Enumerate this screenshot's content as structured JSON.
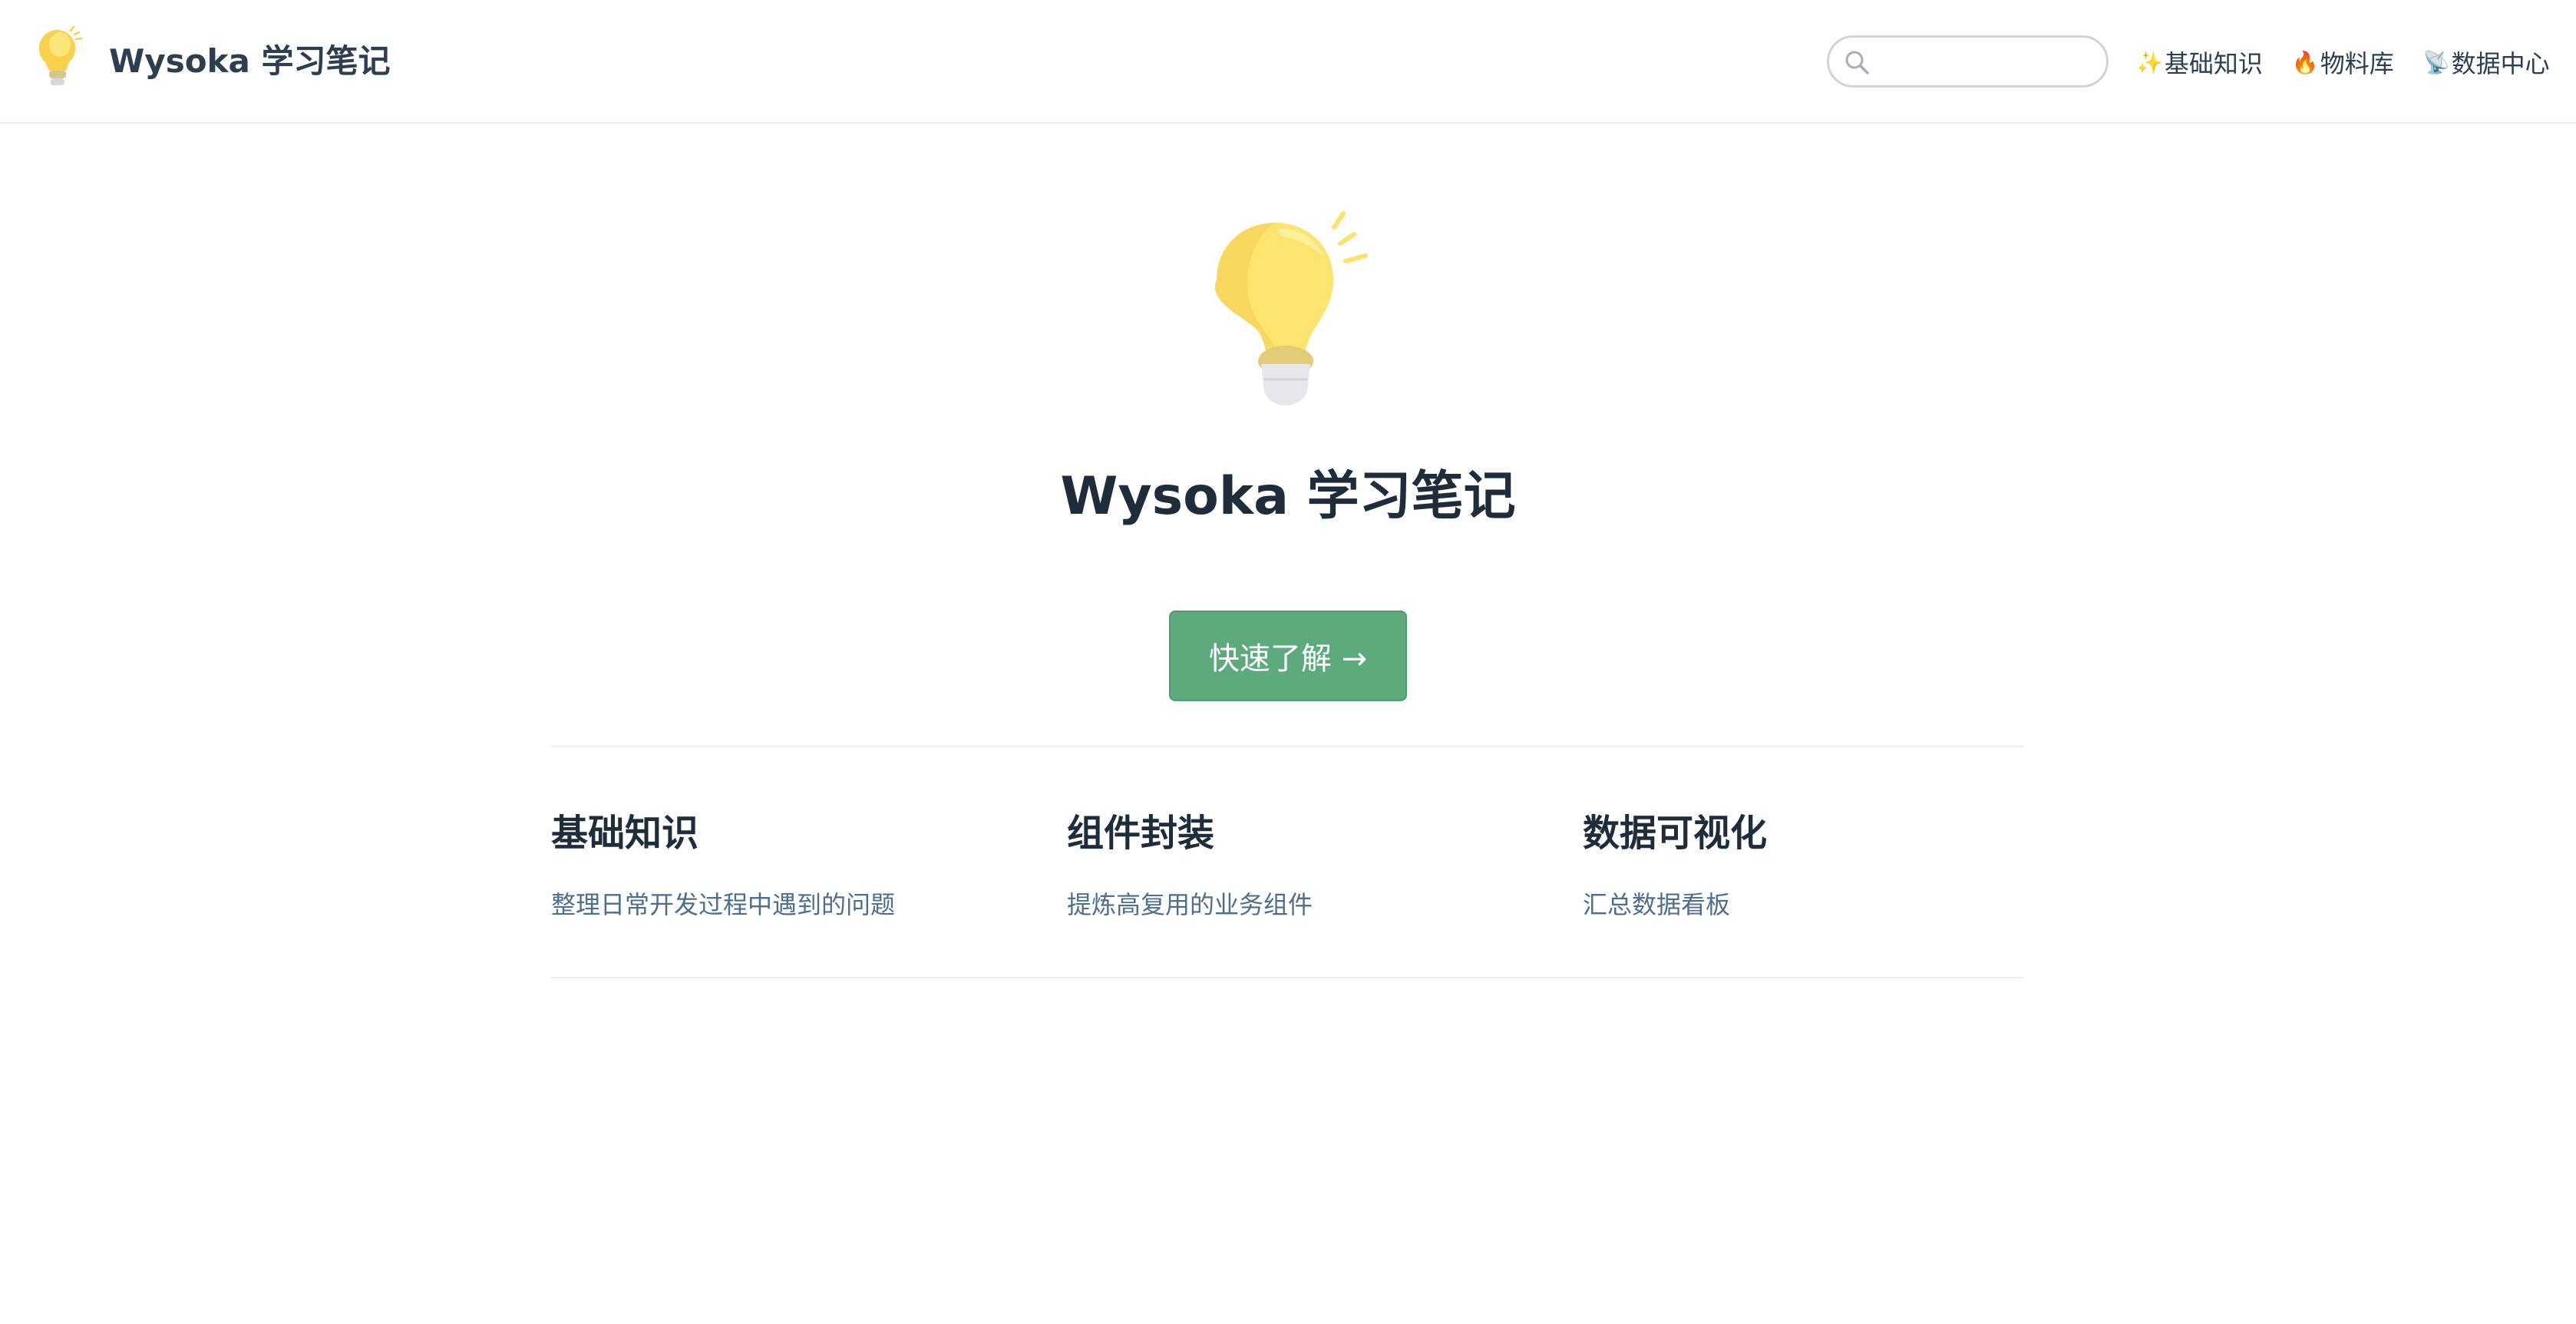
{
  "navbar": {
    "brand_title": "Wysoka 学习笔记",
    "logo_icon": "lightbulb-icon",
    "search": {
      "placeholder": "",
      "value": ""
    },
    "links": [
      {
        "emoji": "✨",
        "label": "基础知识"
      },
      {
        "emoji": "🔥",
        "label": "物料库"
      },
      {
        "emoji": "📡",
        "label": "数据中心"
      }
    ]
  },
  "hero": {
    "logo_icon": "lightbulb-icon",
    "title": "Wysoka 学习笔记",
    "action_label": "快速了解 →"
  },
  "features": [
    {
      "title": "基础知识",
      "details": "整理日常开发过程中遇到的问题"
    },
    {
      "title": "组件封装",
      "details": "提炼高复用的业务组件"
    },
    {
      "title": "数据可视化",
      "details": "汇总数据看板"
    }
  ],
  "colors": {
    "accent": "#5dab7c",
    "text": "#2c3e50",
    "muted": "#4e6e8e",
    "border": "#eaecef",
    "bulb": "#fde16a"
  }
}
